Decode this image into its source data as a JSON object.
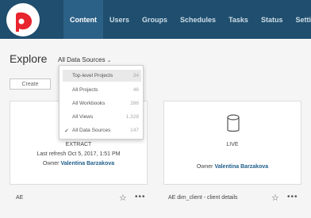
{
  "nav": {
    "items": [
      {
        "label": "Content",
        "active": true
      },
      {
        "label": "Users",
        "active": false
      },
      {
        "label": "Groups",
        "active": false
      },
      {
        "label": "Schedules",
        "active": false
      },
      {
        "label": "Tasks",
        "active": false
      },
      {
        "label": "Status",
        "active": false
      },
      {
        "label": "Settin",
        "active": false
      }
    ]
  },
  "page": {
    "title": "Explore",
    "source_picker": "All Data Sources",
    "create_label": "Create"
  },
  "dropdown": {
    "items": [
      {
        "label": "Top-level Projects",
        "count": "34",
        "checked": false,
        "highlighted": true
      },
      {
        "label": "All Projects",
        "count": "46",
        "checked": false,
        "highlighted": false
      },
      {
        "label": "All Workbooks",
        "count": "286",
        "checked": false,
        "highlighted": false
      },
      {
        "label": "All Views",
        "count": "1,328",
        "checked": false,
        "highlighted": false
      },
      {
        "label": "All Data Sources",
        "count": "147",
        "checked": true,
        "highlighted": false
      }
    ]
  },
  "cards": {
    "left": {
      "type": "EXTRACT",
      "refresh": "Last refresh Oct 5, 2017, 1:51 PM",
      "owner_prefix": "Owner",
      "owner_name": "Valentina Barzakova",
      "name": "AE"
    },
    "right": {
      "type": "LIVE",
      "owner_prefix": "Owner",
      "owner_name": "Valentina Barzakova",
      "name": "AE dim_client - client details"
    }
  },
  "icons": {
    "logo": "tableau-logo",
    "chevron": "chevron-down-icon",
    "database": "database-icon",
    "star": "star-icon",
    "more": "more-icon",
    "check": "checkmark-icon"
  },
  "colors": {
    "topbar": "#1f4e6e",
    "active_tab": "#2c6187",
    "logo_red": "#e8242e",
    "link": "#1f5e8a"
  }
}
